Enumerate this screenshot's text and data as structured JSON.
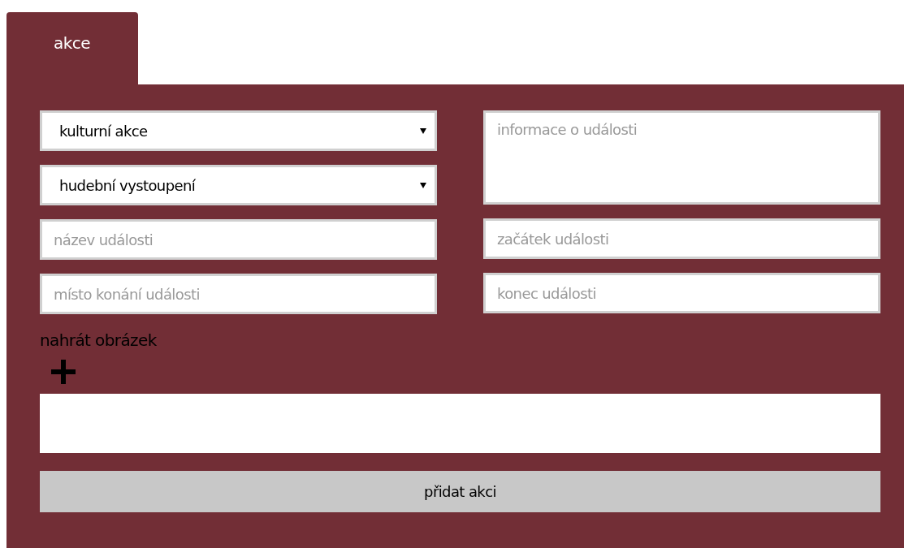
{
  "tabs": [
    {
      "label": "akce",
      "selected": true
    }
  ],
  "selects": [
    {
      "value": "kulturní akce"
    },
    {
      "value": "hudební vystoupení"
    }
  ],
  "left_fields": [
    {
      "placeholder": "název události"
    },
    {
      "placeholder": "místo konání události"
    }
  ],
  "info": {
    "placeholder": "informace o události"
  },
  "right_fields": [
    {
      "placeholder": "začátek události"
    },
    {
      "placeholder": "konec události"
    }
  ],
  "upload": {
    "label": "nahrát obrázek"
  },
  "submit": {
    "label": "přidat akci"
  }
}
